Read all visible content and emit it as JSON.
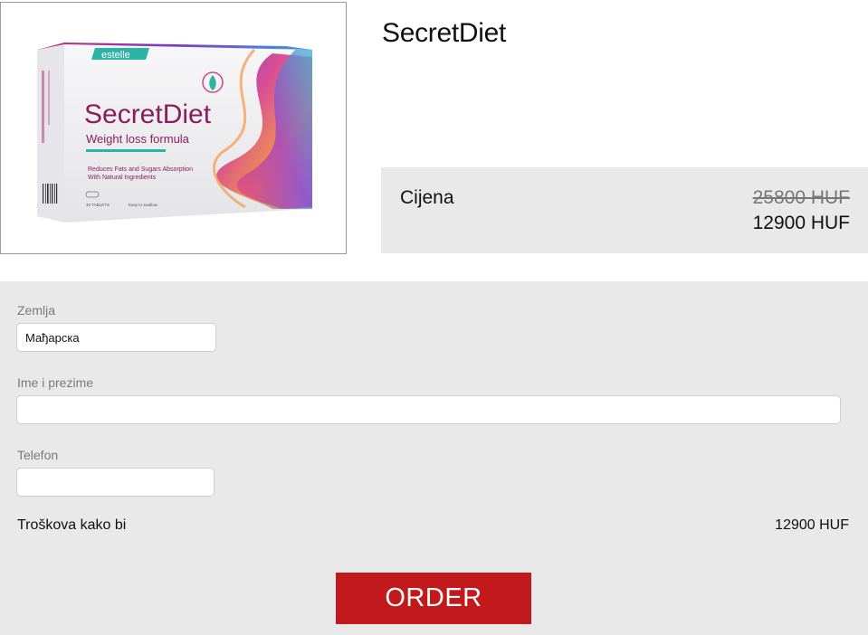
{
  "product": {
    "title": "SecretDiet",
    "image": {
      "brand": "estelle",
      "name": "SecretDiet",
      "subtitle": "Weight loss formula",
      "claim_line1": "Reduces Fats and Sugars Absorption",
      "claim_line2": "With Natural Ingredients",
      "tablets": "30 TABLETS",
      "swallow": "Easy to swallow"
    }
  },
  "price": {
    "label": "Cijena",
    "old": "25800 HUF",
    "new": "12900 HUF"
  },
  "form": {
    "country_label": "Zemlja",
    "country_value": "Мађарска",
    "name_label": "Ime i prezime",
    "name_value": "",
    "phone_label": "Telefon",
    "phone_value": "",
    "total_label": "Troškova kako bi",
    "total_value": "12900 HUF",
    "order_label": "ORDER"
  },
  "colors": {
    "brand_purple": "#8a1d5c",
    "order_red": "#c21a1c",
    "panel_gray": "#e9e9e9"
  }
}
